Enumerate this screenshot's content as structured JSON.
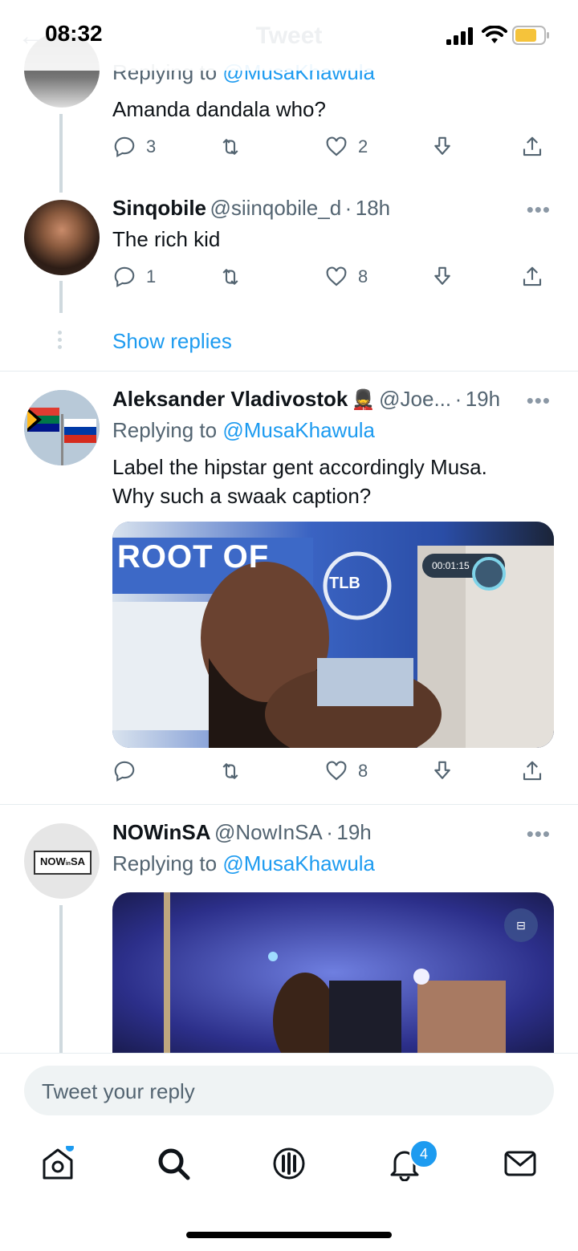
{
  "status_bar": {
    "time": "08:32"
  },
  "nav": {
    "title": "Tweet"
  },
  "tweets": [
    {
      "replying_label": "Replying to",
      "replying_to": "@MusaKhawula",
      "text": "Amanda dandala who?",
      "replies": "3",
      "likes": "2"
    },
    {
      "name": "Sinqobile",
      "handle": "@siinqobile_d",
      "time": "18h",
      "text": "The rich kid",
      "replies": "1",
      "likes": "8"
    },
    {
      "name": "Aleksander Vladivostok",
      "emoji": "💂",
      "handle": "@Joe...",
      "time": "19h",
      "replying_label": "Replying to",
      "replying_to": "@MusaKhawula",
      "text_line1": "Label the hipstar gent accordingly Musa.",
      "text_line2": "Why such a swaak caption?",
      "likes": "8",
      "media": {
        "banner_text": "ROOT OF",
        "logo_text": "TLB",
        "timer": "00:01:15"
      }
    },
    {
      "name": "NOWinSA",
      "handle": "@NowInSA",
      "time": "19h",
      "replying_label": "Replying to",
      "replying_to": "@MusaKhawula",
      "avatar_text": "NOW",
      "avatar_text2": "SA",
      "avatar_in": "in"
    }
  ],
  "show_replies": "Show replies",
  "reply_bar": {
    "placeholder": "Tweet your reply"
  },
  "tabbar": {
    "notifications_badge": "4"
  },
  "colors": {
    "accent": "#1d9bf0",
    "secondary_text": "#536471"
  }
}
